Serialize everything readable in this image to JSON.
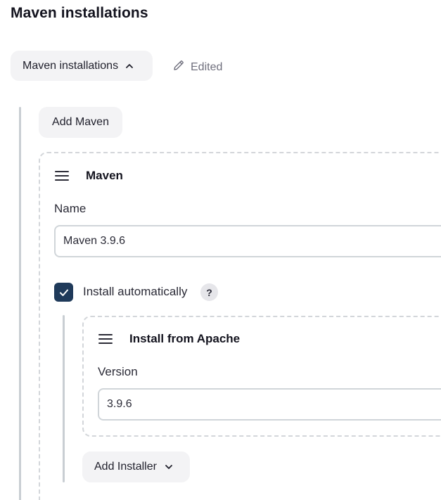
{
  "section": {
    "title": "Maven installations"
  },
  "toggle": {
    "label": "Maven installations",
    "icon": "chevron-up-icon"
  },
  "status": {
    "edited_label": "Edited",
    "icon": "pencil-icon"
  },
  "add_maven": {
    "label": "Add Maven"
  },
  "maven_card": {
    "title": "Maven",
    "name_label": "Name",
    "name_value": "Maven 3.9.6",
    "install_automatically": {
      "label": "Install automatically",
      "checked": true,
      "help": "?"
    }
  },
  "installer_card": {
    "title": "Install from Apache",
    "version_label": "Version",
    "version_value": "3.9.6"
  },
  "add_installer": {
    "label": "Add Installer",
    "icon": "chevron-down-icon"
  },
  "colors": {
    "checkbox": "#1f3a5a",
    "button_bg": "#f3f3f5",
    "dashed_border": "#d3d6da",
    "rail": "#c9ced3"
  }
}
